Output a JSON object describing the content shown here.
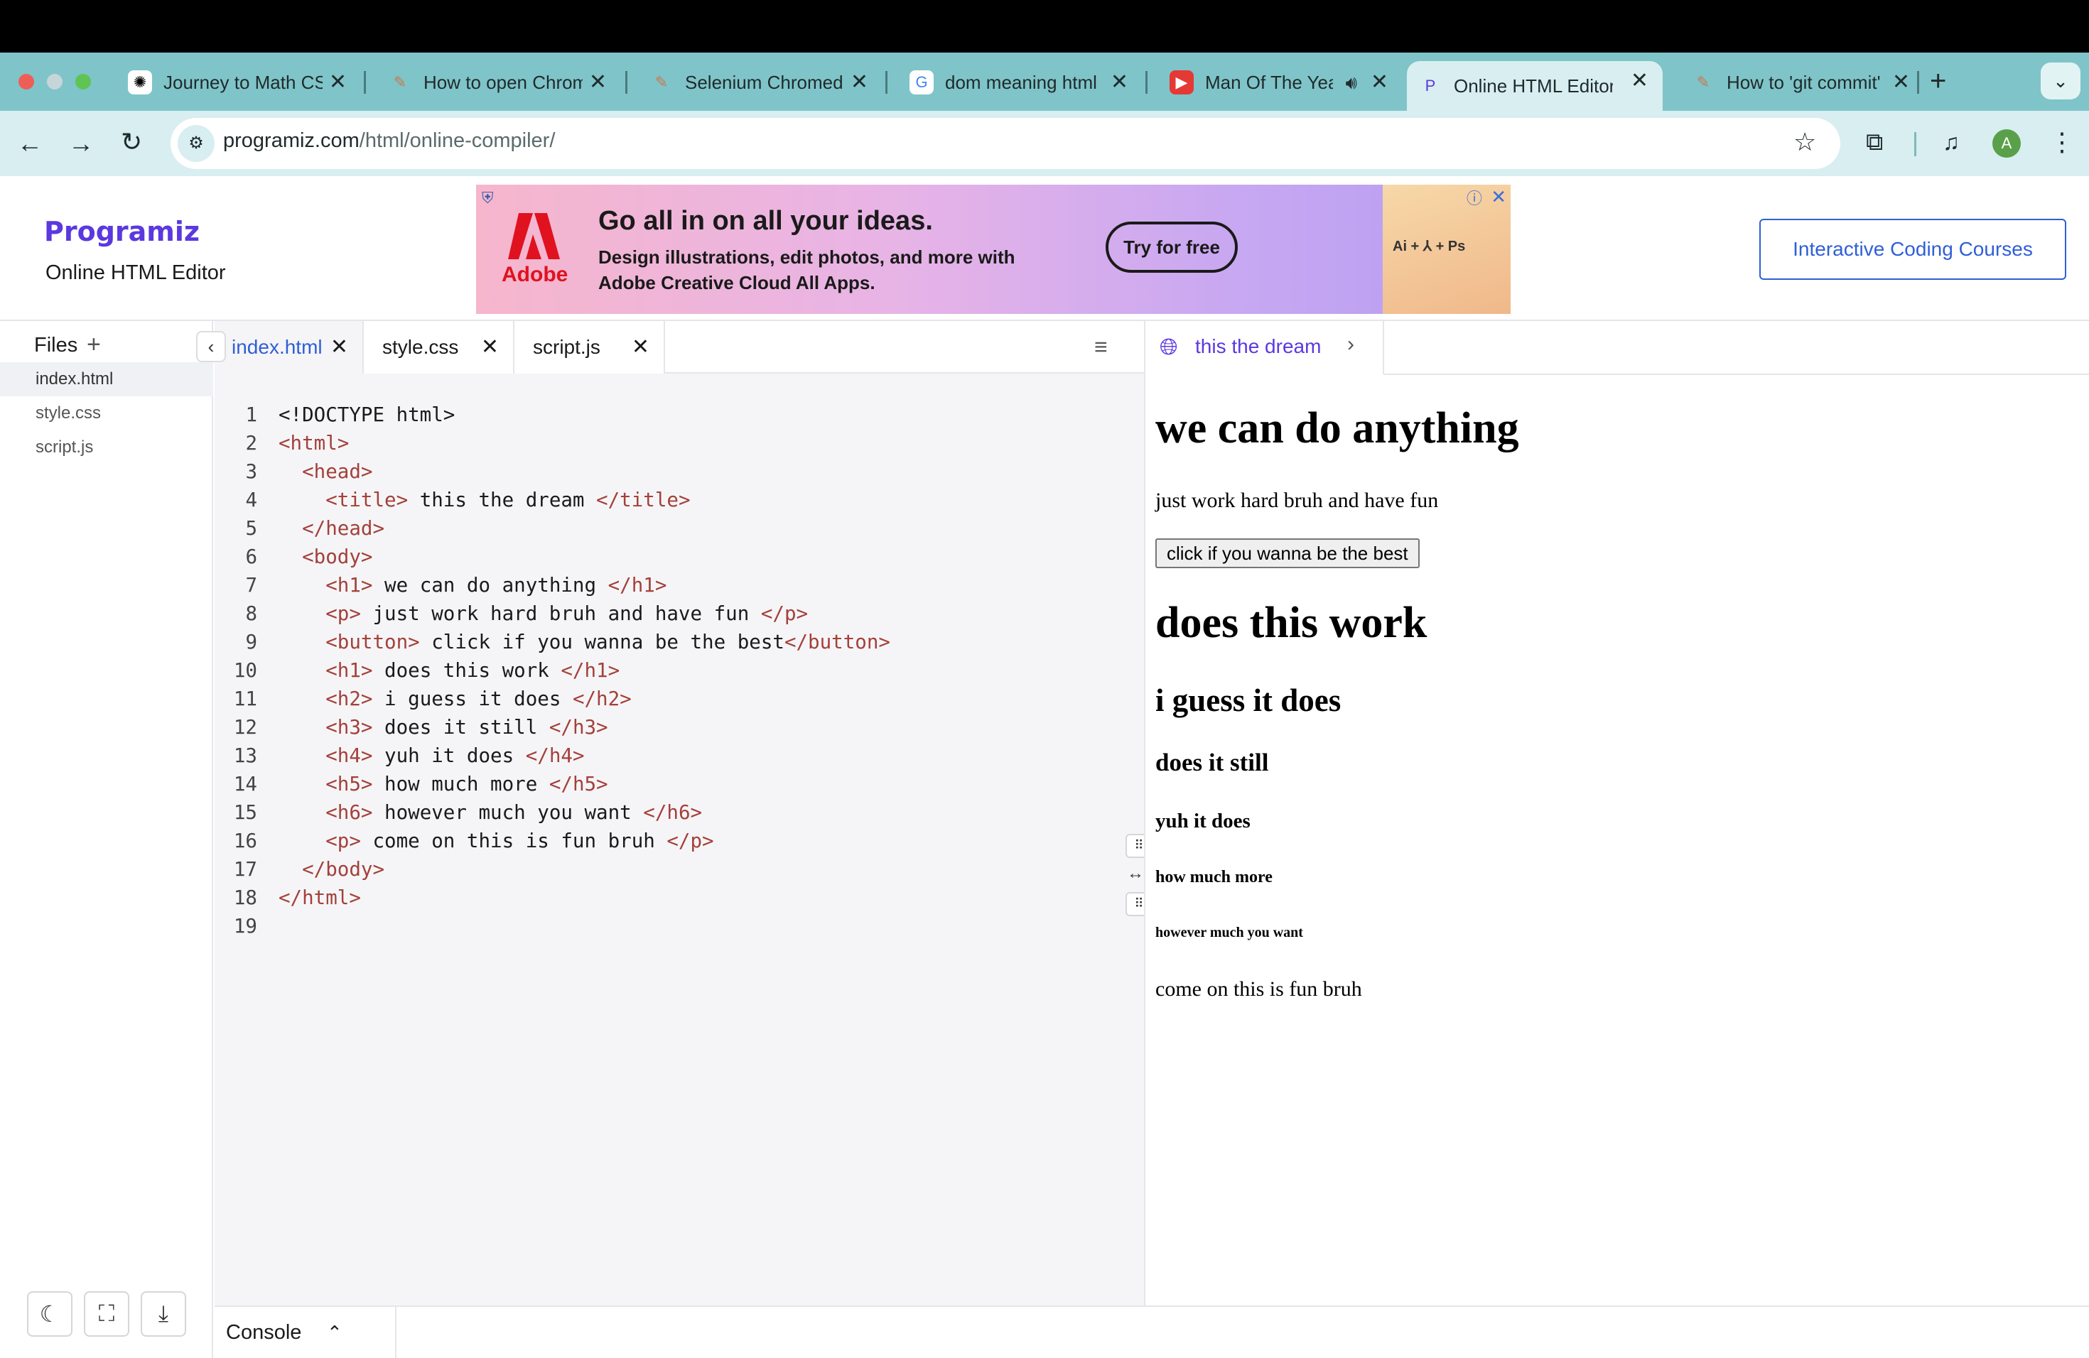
{
  "browser": {
    "tabs": [
      {
        "title": "Journey to Math CS",
        "icon": "openai-icon"
      },
      {
        "title": "How to open Chrom",
        "icon": "pen-icon"
      },
      {
        "title": "Selenium Chromedr",
        "icon": "pen-icon"
      },
      {
        "title": "dom meaning html",
        "icon": "google-icon"
      },
      {
        "title": "Man Of The Yea",
        "icon": "youtube-icon"
      },
      {
        "title": "Online HTML Editor",
        "icon": "programiz-icon"
      },
      {
        "title": "How to 'git commit'",
        "icon": "pen-icon"
      }
    ],
    "new_tab": "+",
    "url_host": "programiz.com",
    "url_path": "/html/online-compiler/",
    "profile_initial": "A"
  },
  "site": {
    "logo": "Programiz",
    "subtitle": "Online HTML Editor",
    "cta": "Interactive Coding Courses"
  },
  "ad": {
    "brand": "Adobe",
    "headline": "Go all in on all your ideas.",
    "body": "Design illustrations, edit photos, and more with Adobe Creative Cloud All Apps.",
    "button": "Try for free",
    "apps": "Ai + ⅄ + Ps"
  },
  "files": {
    "heading": "Files",
    "add": "+",
    "items": [
      "index.html",
      "style.css",
      "script.js"
    ]
  },
  "editor": {
    "tabs": [
      "index.html",
      "style.css",
      "script.js"
    ],
    "lines": [
      {
        "n": "1",
        "indent": "",
        "open": "",
        "text": "<!DOCTYPE html>",
        "close": ""
      },
      {
        "n": "2",
        "indent": "",
        "open": "<html>",
        "text": "",
        "close": ""
      },
      {
        "n": "3",
        "indent": "  ",
        "open": "<head>",
        "text": "",
        "close": ""
      },
      {
        "n": "4",
        "indent": "    ",
        "open": "<title>",
        "text": " this the dream ",
        "close": "</title>"
      },
      {
        "n": "5",
        "indent": "  ",
        "open": "</head>",
        "text": "",
        "close": ""
      },
      {
        "n": "6",
        "indent": "  ",
        "open": "<body>",
        "text": "",
        "close": ""
      },
      {
        "n": "7",
        "indent": "    ",
        "open": "<h1>",
        "text": " we can do anything ",
        "close": "</h1>"
      },
      {
        "n": "8",
        "indent": "    ",
        "open": "<p>",
        "text": " just work hard bruh and have fun ",
        "close": "</p>"
      },
      {
        "n": "9",
        "indent": "    ",
        "open": "<button>",
        "text": " click if you wanna be the best",
        "close": "</button>"
      },
      {
        "n": "10",
        "indent": "    ",
        "open": "<h1>",
        "text": " does this work ",
        "close": "</h1>"
      },
      {
        "n": "11",
        "indent": "    ",
        "open": "<h2>",
        "text": " i guess it does ",
        "close": "</h2>"
      },
      {
        "n": "12",
        "indent": "    ",
        "open": "<h3>",
        "text": " does it still ",
        "close": "</h3>"
      },
      {
        "n": "13",
        "indent": "    ",
        "open": "<h4>",
        "text": " yuh it does ",
        "close": "</h4>"
      },
      {
        "n": "14",
        "indent": "    ",
        "open": "<h5>",
        "text": " how much more ",
        "close": "</h5>"
      },
      {
        "n": "15",
        "indent": "    ",
        "open": "<h6>",
        "text": " however much you want ",
        "close": "</h6>"
      },
      {
        "n": "16",
        "indent": "    ",
        "open": "<p>",
        "text": " come on this is fun bruh ",
        "close": "</p>"
      },
      {
        "n": "17",
        "indent": "  ",
        "open": "</body>",
        "text": "",
        "close": ""
      },
      {
        "n": "18",
        "indent": "",
        "open": "</html>",
        "text": "",
        "close": ""
      },
      {
        "n": "19",
        "indent": "",
        "open": "",
        "text": "",
        "close": ""
      }
    ]
  },
  "preview": {
    "tab_title": "this the dream",
    "h1": "we can do anything",
    "p1": "just work hard bruh and have fun",
    "button": "click if you wanna be the best",
    "h1b": "does this work",
    "h2": "i guess it does",
    "h3": "does it still",
    "h4": "yuh it does",
    "h5": "how much more",
    "h6": "however much you want",
    "p2": "come on this is fun bruh"
  },
  "console": {
    "label": "Console"
  },
  "colors": {
    "accent": "#5b38e0",
    "link": "#2f5fd7",
    "tag": "#a4403a",
    "chrome": "#7fc4c9"
  }
}
